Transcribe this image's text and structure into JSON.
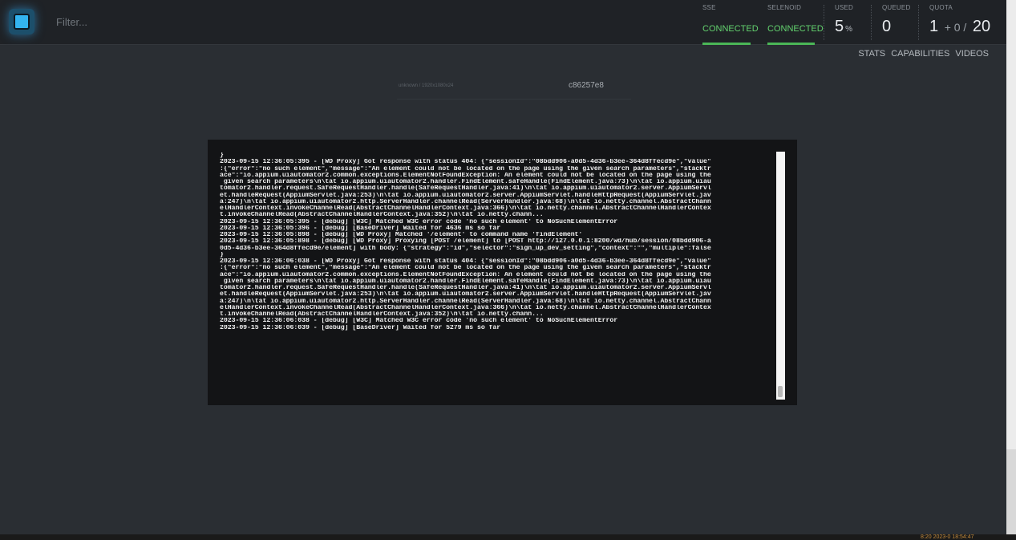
{
  "header": {
    "filter_placeholder": "Filter...",
    "sse_label": "SSE",
    "sse_status": "CONNECTED",
    "selenoid_label": "SELENOID",
    "selenoid_status": "CONNECTED",
    "used_label": "USED",
    "used_value": "5",
    "used_unit": "%",
    "queued_label": "QUEUED",
    "queued_value": "0",
    "quota_label": "QUOTA",
    "quota_used": "1",
    "quota_plus": "+ 0 /",
    "quota_total": "20"
  },
  "nav": {
    "stats": "STATS",
    "capabilities": "CAPABILITIES",
    "videos": "VIDEOS"
  },
  "session": {
    "meta": "unknown / 1920x1080x24",
    "id": "c86257e8"
  },
  "log_lines": [
    "}",
    "2023-09-15 12:36:05:395 - [WD Proxy] Got response with status 404: {\"sessionId\":\"08bdd906-a0d5-4d36-b3ee-364d8ffecd9e\",\"value\"",
    ":{\"error\":\"no such element\",\"message\":\"An element could not be located on the page using the given search parameters\",\"stacktr",
    "ace\":\"io.appium.uiautomator2.common.exceptions.ElementNotFoundException: An element could not be located on the page using the",
    " given search parameters\\n\\tat io.appium.uiautomator2.handler.FindElement.safeHandle(FindElement.java:73)\\n\\tat io.appium.uiau",
    "tomator2.handler.request.SafeRequestHandler.handle(SafeRequestHandler.java:41)\\n\\tat io.appium.uiautomator2.server.AppiumServl",
    "et.handleRequest(AppiumServlet.java:253)\\n\\tat io.appium.uiautomator2.server.AppiumServlet.handleHttpRequest(AppiumServlet.jav",
    "a:247)\\n\\tat io.appium.uiautomator2.http.ServerHandler.channelRead(ServerHandler.java:68)\\n\\tat io.netty.channel.AbstractChann",
    "elHandlerContext.invokeChannelRead(AbstractChannelHandlerContext.java:366)\\n\\tat io.netty.channel.AbstractChannelHandlerContex",
    "t.invokeChannelRead(AbstractChannelHandlerContext.java:352)\\n\\tat io.netty.chann...",
    "2023-09-15 12:36:05:395 - [debug] [W3C] Matched W3C error code 'no such element' to NoSuchElementError",
    "2023-09-15 12:36:05:396 - [debug] [BaseDriver] Waited for 4636 ms so far",
    "2023-09-15 12:36:05:898 - [debug] [WD Proxy] Matched '/element' to command name 'findElement'",
    "2023-09-15 12:36:05:898 - [debug] [WD Proxy] Proxying [POST /element] to [POST http://127.0.0.1:8200/wd/hub/session/08bdd906-a",
    "0d5-4d36-b3ee-364d8ffecd9e/element] with body: {\"strategy\":\"id\",\"selector\":\"sign_up_dev_setting\",\"context\":\"\",\"multiple\":false",
    "}",
    "2023-09-15 12:36:06:038 - [WD Proxy] Got response with status 404: {\"sessionId\":\"08bdd906-a0d5-4d36-b3ee-364d8ffecd9e\",\"value\"",
    ":{\"error\":\"no such element\",\"message\":\"An element could not be located on the page using the given search parameters\",\"stacktr",
    "ace\":\"io.appium.uiautomator2.common.exceptions.ElementNotFoundException: An element could not be located on the page using the",
    " given search parameters\\n\\tat io.appium.uiautomator2.handler.FindElement.safeHandle(FindElement.java:73)\\n\\tat io.appium.uiau",
    "tomator2.handler.request.SafeRequestHandler.handle(SafeRequestHandler.java:41)\\n\\tat io.appium.uiautomator2.server.AppiumServl",
    "et.handleRequest(AppiumServlet.java:253)\\n\\tat io.appium.uiautomator2.server.AppiumServlet.handleHttpRequest(AppiumServlet.jav",
    "a:247)\\n\\tat io.appium.uiautomator2.http.ServerHandler.channelRead(ServerHandler.java:68)\\n\\tat io.netty.channel.AbstractChann",
    "elHandlerContext.invokeChannelRead(AbstractChannelHandlerContext.java:366)\\n\\tat io.netty.channel.AbstractChannelHandlerContex",
    "t.invokeChannelRead(AbstractChannelHandlerContext.java:352)\\n\\tat io.netty.chann...",
    "2023-09-15 12:36:06:038 - [debug] [W3C] Matched W3C error code 'no such element' to NoSuchElementError",
    "2023-09-15 12:36:06:039 - [debug] [BaseDriver] Waited for 5279 ms so far"
  ],
  "taskbar": {
    "clock": "8:20  2023-0  18:54:47"
  },
  "colors": {
    "accent": "#33b4f0",
    "connected": "#63d26e",
    "background": "#2a2e33",
    "log_background": "#131416"
  }
}
